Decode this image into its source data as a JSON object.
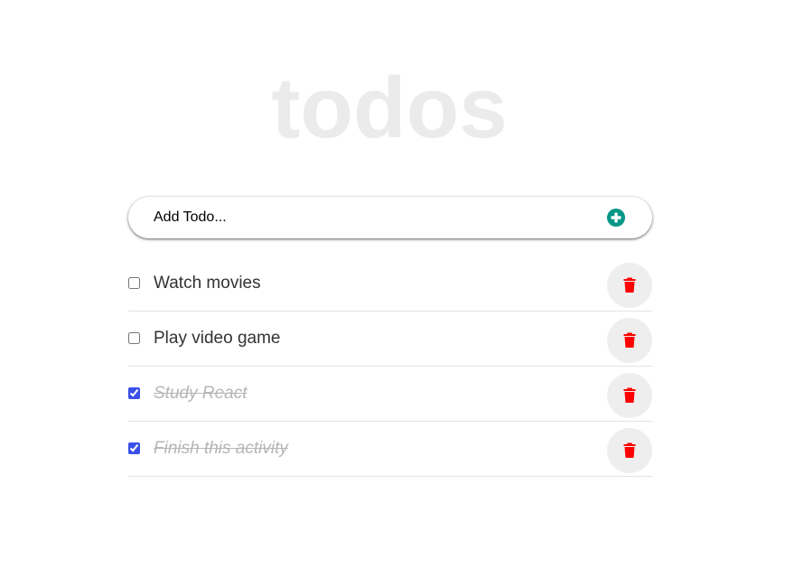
{
  "app": {
    "title": "todos"
  },
  "add_todo": {
    "placeholder": "Add Todo...",
    "button_icon": "plus-circle-icon",
    "button_color": "#009688"
  },
  "todos": [
    {
      "label": "Watch movies",
      "completed": false
    },
    {
      "label": "Play video game",
      "completed": false
    },
    {
      "label": "Study React",
      "completed": true
    },
    {
      "label": "Finish this activity",
      "completed": true
    }
  ],
  "colors": {
    "title": "#ebebeb",
    "delete_icon": "#ff0000",
    "checkbox_checked": "#3a4fe8",
    "completed_text": "#b6b6b6"
  },
  "icons": {
    "delete": "trash-icon"
  }
}
